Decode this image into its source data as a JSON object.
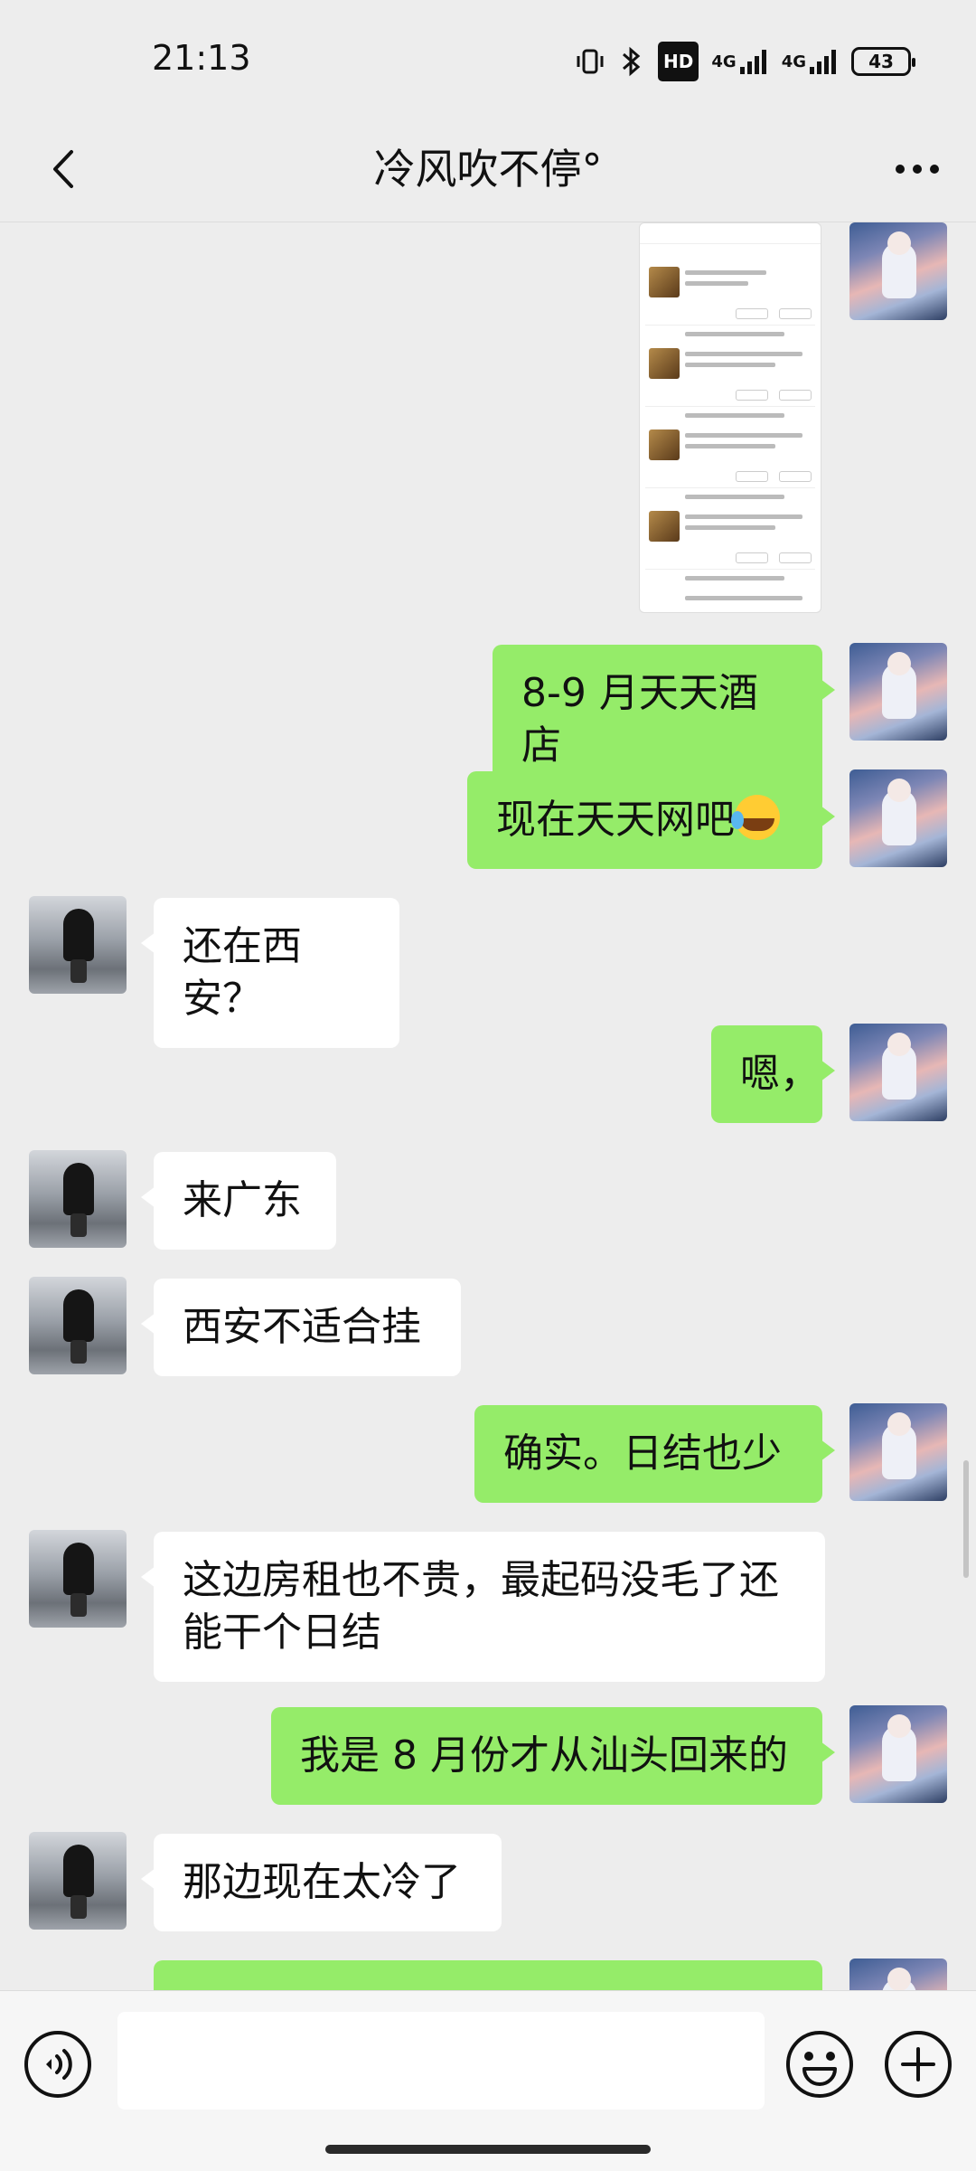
{
  "status_bar": {
    "time": "21:13",
    "network_1": "4G",
    "network_2": "4G",
    "hd_badge": "HD",
    "battery": "43",
    "icons": [
      "vibrate-icon",
      "bluetooth-icon",
      "hd-icon",
      "signal-icon",
      "signal-icon",
      "battery-icon"
    ]
  },
  "header": {
    "title": "冷风吹不停°",
    "back_icon": "chevron-left-icon",
    "more_icon": "more-dots-icon"
  },
  "messages": [
    {
      "from": "me",
      "type": "image"
    },
    {
      "from": "me",
      "text": "8-9 月天天酒店"
    },
    {
      "from": "me",
      "text": "现在天天网吧",
      "emoji": "crying-laughing-emoji"
    },
    {
      "from": "them",
      "text": "还在西安？"
    },
    {
      "from": "me",
      "text": "嗯，"
    },
    {
      "from": "them",
      "text": "来广东"
    },
    {
      "from": "them",
      "text": "西安不适合挂"
    },
    {
      "from": "me",
      "text": "确实。日结也少"
    },
    {
      "from": "them",
      "text": "这边房租也不贵，最起码没毛了还能干个日结"
    },
    {
      "from": "me",
      "text": "我是 8 月份才从汕头回来的"
    },
    {
      "from": "them",
      "text": "那边现在太冷了"
    },
    {
      "from": "me",
      "text": ""
    }
  ],
  "input_bar": {
    "voice_icon": "voice-icon",
    "emoji_icon": "emoji-icon",
    "plus_icon": "plus-icon",
    "input_value": ""
  },
  "colors": {
    "background": "#ededed",
    "bubble_me": "#95ec69",
    "bubble_them": "#ffffff",
    "input_bar": "#f6f6f6"
  }
}
